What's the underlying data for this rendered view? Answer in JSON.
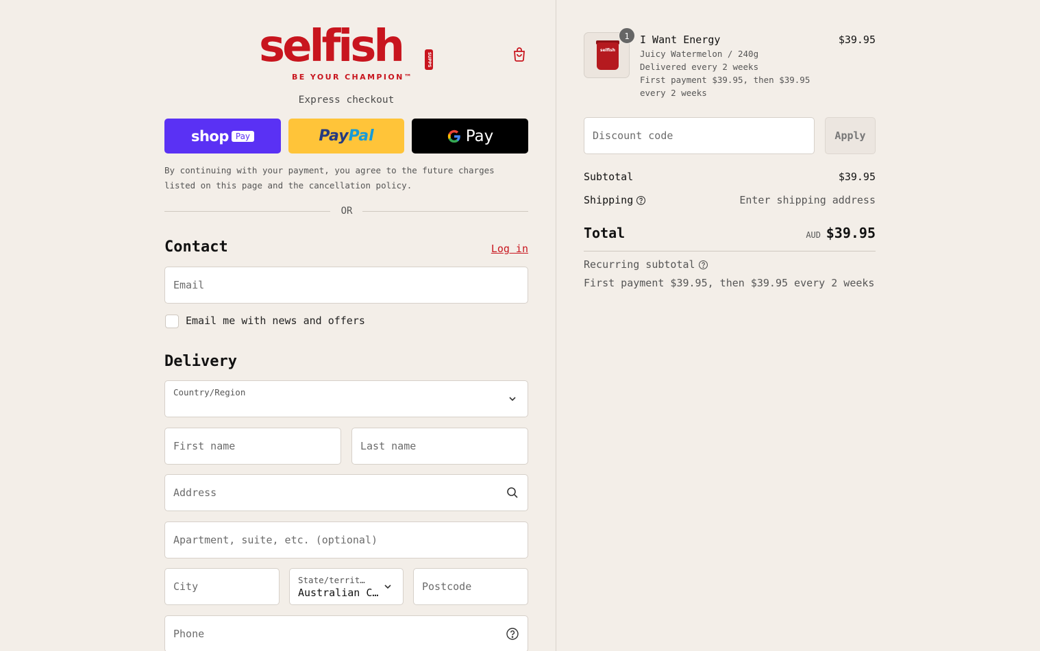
{
  "brand": {
    "name": "selfish",
    "badge": "SUPPS",
    "tagline": "BE YOUR CHAMPION™",
    "color": "#c8151e"
  },
  "express": {
    "label": "Express checkout",
    "shoppay": {
      "text": "shop",
      "pill": "Pay"
    },
    "paypal": {
      "part1": "Pay",
      "part2": "Pal"
    },
    "gpay": {
      "text": "Pay"
    }
  },
  "legal_text": "By continuing with your payment, you agree to the future charges listed on this page and the cancellation policy.",
  "or_label": "OR",
  "contact": {
    "title": "Contact",
    "login_label": "Log in",
    "email_placeholder": "Email",
    "newsletter_label": "Email me with news and offers"
  },
  "delivery": {
    "title": "Delivery",
    "country_label": "Country/Region",
    "country_value": "",
    "first_name_placeholder": "First name",
    "last_name_placeholder": "Last name",
    "address_placeholder": "Address",
    "apartment_placeholder": "Apartment, suite, etc. (optional)",
    "city_placeholder": "City",
    "state_label": "State/territ…",
    "state_value": "Australian C…",
    "postcode_placeholder": "Postcode",
    "phone_placeholder": "Phone"
  },
  "cart": {
    "item": {
      "quantity": "1",
      "name": "I Want Energy",
      "price": "$39.95",
      "variant": "Juicy Watermelon / 240g",
      "delivery": "Delivered every 2 weeks",
      "payment_line1": "First payment $39.95, then $39.95",
      "payment_line2": "every 2 weeks",
      "thumb_label": "selfish"
    },
    "discount_placeholder": "Discount code",
    "apply_label": "Apply",
    "subtotal_label": "Subtotal",
    "subtotal_value": "$39.95",
    "shipping_label": "Shipping",
    "shipping_value": "Enter shipping address",
    "total_label": "Total",
    "total_currency": "AUD",
    "total_value": "$39.95",
    "recurring_label": "Recurring subtotal",
    "recurring_text": "First payment $39.95, then $39.95 every 2 weeks"
  },
  "icons": {
    "bag": "shopping-bag-icon",
    "chevron": "chevron-down-icon",
    "search": "search-icon",
    "help": "help-circle-icon"
  }
}
